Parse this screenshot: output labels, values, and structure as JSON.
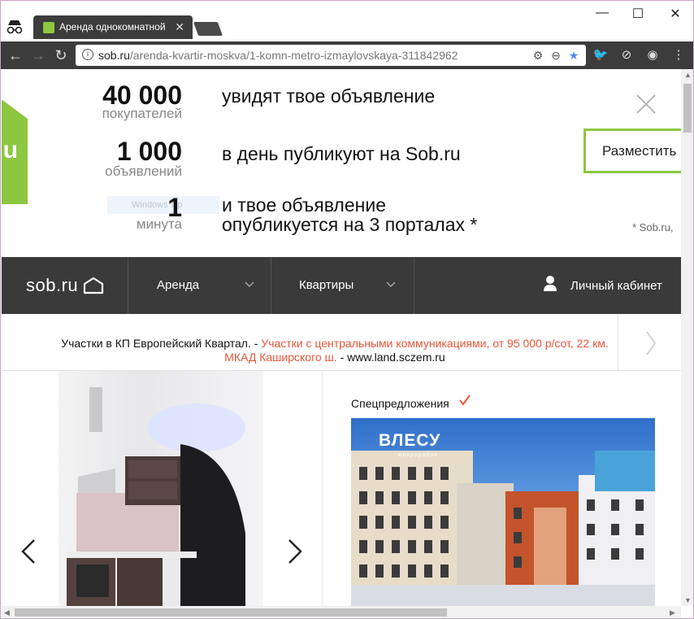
{
  "browser": {
    "tab_title": "Аренда однокомнатной",
    "url_host": "sob.ru",
    "url_path": "/arenda-kvartir-moskva/1-komn-metro-izmaylovskaya-311842962"
  },
  "promo": {
    "logo_letter": "u",
    "stats": [
      {
        "number": "40 000",
        "unit": "покупателей",
        "text": "увидят твое объявление"
      },
      {
        "number": "1 000",
        "unit": "объявлений",
        "text": "в день публикуют на Sob.ru"
      },
      {
        "number": "1",
        "unit": "минута",
        "text_line1": "и твое объявление",
        "text_line2": "опубликуется на 3 порталах *"
      }
    ],
    "ghost_label": "Windows Tip",
    "place_button": "Разместить",
    "footnote": "* Sob.ru,"
  },
  "site_nav": {
    "brand": "sob.ru",
    "items": [
      "Аренда",
      "Квартиры"
    ],
    "cabinet": "Личный кабинет"
  },
  "ad": {
    "lead": "Участки в КП Европейский Квартал. - ",
    "highlight": "Участки с центральными коммуникациями, от 95 000 р/сот, 22 км. МКАД Каширского ш.",
    "tail": " - www.land.sczem.ru"
  },
  "special": {
    "title": "Спецпредложения",
    "offer_logo": "ВЛЕСУ",
    "offer_sub": "микрорайон"
  },
  "colors": {
    "brand_green": "#8dc63f",
    "nav_dark": "#3a3a3a",
    "ad_red": "#e8553a"
  }
}
